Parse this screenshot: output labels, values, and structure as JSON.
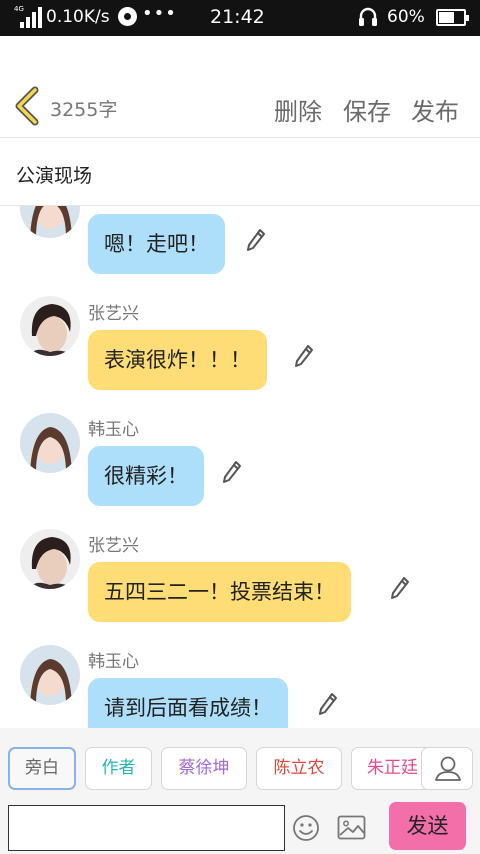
{
  "status_bar": {
    "network": "4G",
    "speed": "0.10K/s",
    "more": "•••",
    "time": "21:42",
    "battery": "60%"
  },
  "header": {
    "word_count": "3255字",
    "delete_label": "删除",
    "save_label": "保存",
    "publish_label": "发布"
  },
  "section_title": "公演现场",
  "messages": [
    {
      "sender": "",
      "text": "嗯！走吧！",
      "color": "blue"
    },
    {
      "sender": "张艺兴",
      "text": "表演很炸！！！",
      "color": "yellow"
    },
    {
      "sender": "韩玉心",
      "text": "很精彩！",
      "color": "blue"
    },
    {
      "sender": "张艺兴",
      "text": "五四三二一！投票结束！",
      "color": "yellow"
    },
    {
      "sender": "韩玉心",
      "text": "请到后面看成绩！",
      "color": "blue"
    }
  ],
  "roles": [
    {
      "label": "旁白",
      "color": "#666666"
    },
    {
      "label": "作者",
      "color": "#27b5b3"
    },
    {
      "label": "蔡徐坤",
      "color": "#a46ad6"
    },
    {
      "label": "陈立农",
      "color": "#e0473a"
    },
    {
      "label": "朱正廷",
      "color": "#e34b8f"
    }
  ],
  "input": {
    "value": "",
    "placeholder": ""
  },
  "send_label": "发送",
  "colors": {
    "bubble_blue": "#aedffa",
    "bubble_yellow": "#fedd76",
    "send_pink": "#f36faa",
    "back_arrow_yellow": "#f5d84a"
  },
  "icons": [
    "back-arrow-icon",
    "edit-pencil-icon",
    "emoji-icon",
    "image-icon",
    "person-icon",
    "headset-icon",
    "battery-icon"
  ]
}
